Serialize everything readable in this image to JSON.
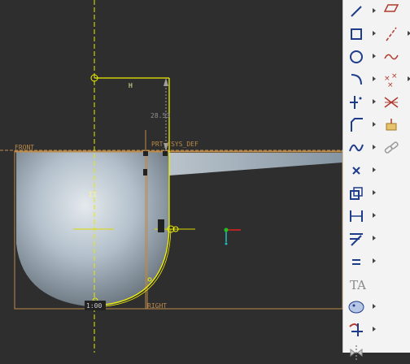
{
  "viewport": {
    "datum_front": "FRONT",
    "datum_right": "RIGHT",
    "csys": "PRT_CSYS_DEF",
    "dim_value": "28.53",
    "constraint_h": "H",
    "constraint_v": "II"
  },
  "toolbar": {
    "buttons": [
      {
        "name": "line-icon"
      },
      {
        "name": "rectangle-icon"
      },
      {
        "name": "circle-icon"
      },
      {
        "name": "arc-icon"
      },
      {
        "name": "fillet-icon"
      },
      {
        "name": "chamfer-icon"
      },
      {
        "name": "spline-icon"
      },
      {
        "name": "point-icon"
      },
      {
        "name": "offset-icon"
      },
      {
        "name": "dimension-icon"
      },
      {
        "name": "modify-icon"
      },
      {
        "name": "constraint-icon"
      },
      {
        "name": "text-icon"
      },
      {
        "name": "palette-icon"
      },
      {
        "name": "trim-icon"
      },
      {
        "name": "mirror-icon"
      }
    ],
    "secondary": [
      {
        "name": "parallelogram-icon"
      },
      {
        "name": "centerline-icon"
      },
      {
        "name": "freehand-spline-icon"
      },
      {
        "name": "multi-point-icon"
      },
      {
        "name": "intersect-icon"
      },
      {
        "name": "weight-icon"
      },
      {
        "name": "link-icon"
      }
    ]
  },
  "colors": {
    "background": "#2e2e2e",
    "datum": "#b98a4a",
    "sketch": "#f0f000",
    "dimension": "#a0a0a0",
    "surface": "#9fb3c3"
  }
}
